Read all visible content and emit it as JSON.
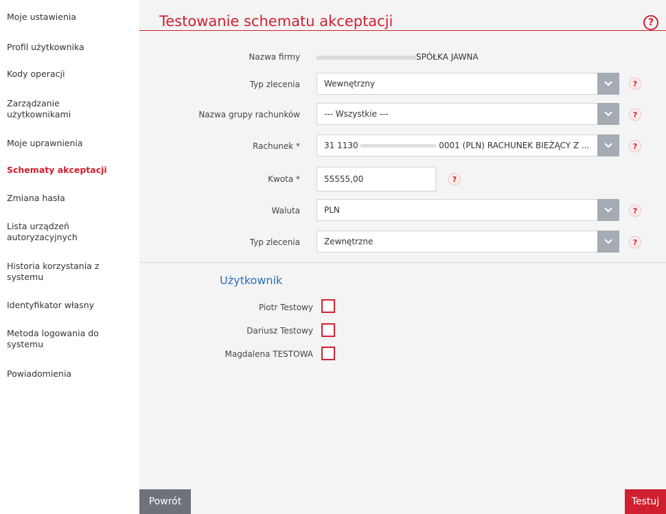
{
  "sidebar": {
    "items": [
      {
        "label": "Moje ustawienia"
      },
      {
        "label": "Profil użytkownika"
      },
      {
        "label": "Kody operacji"
      },
      {
        "label": "Zarządzanie\nużytkownikami"
      },
      {
        "label": "Moje uprawnienia"
      },
      {
        "label": "Schematy akceptacji",
        "active": true
      },
      {
        "label": "Zmiana hasła"
      },
      {
        "label": "Lista urządzeń\nautoryzacyjnych"
      },
      {
        "label": "Historia korzystania z\nsystemu"
      },
      {
        "label": "Identyfikator własny"
      },
      {
        "label": "Metoda logowania do\nsystemu"
      },
      {
        "label": "Powiadomienia"
      }
    ]
  },
  "header": {
    "title": "Testowanie schematu akceptacji",
    "help": "?"
  },
  "form": {
    "company": {
      "label": "Nazwa firmy",
      "value": "SPÓŁKA JAWNA"
    },
    "order_type": {
      "label": "Typ zlecenia",
      "value": "Wewnętrzny"
    },
    "account_group": {
      "label": "Nazwa grupy rachunków",
      "value": "--- Wszystkie ---"
    },
    "account": {
      "label": "Rachunek *",
      "value_prefix": "31 1130",
      "value_suffix": "0001 (PLN) RACHUNEK BIEŻĄCY Z ..."
    },
    "amount": {
      "label": "Kwota *",
      "value": "55555,00"
    },
    "currency": {
      "label": "Waluta",
      "value": "PLN"
    },
    "order_type2": {
      "label": "Typ zlecenia",
      "value": "Zewnętrzne"
    },
    "help": "?"
  },
  "users": {
    "title": "Użytkownik",
    "items": [
      {
        "name": "Piotr Testowy",
        "checked": false
      },
      {
        "name": "Dariusz Testowy",
        "checked": false
      },
      {
        "name": "Magdalena TESTOWA",
        "checked": false
      }
    ]
  },
  "buttons": {
    "back": "Powrót",
    "test": "Testuj"
  },
  "colors": {
    "accent": "#d0202f",
    "section_blue": "#2a6ebb",
    "select_button": "#a4abb3",
    "back_button": "#6e737a"
  }
}
